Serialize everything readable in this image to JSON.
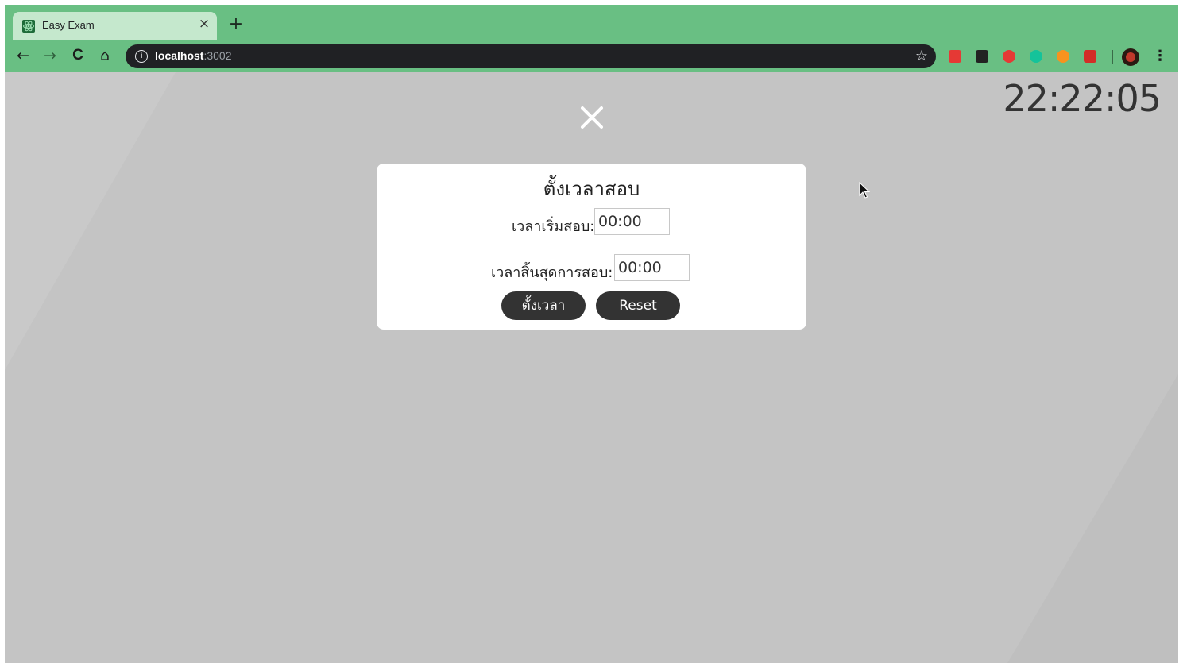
{
  "browser": {
    "tab": {
      "title": "Easy Exam",
      "close_glyph": "×",
      "favicon": "react-icon"
    },
    "new_tab_glyph": "+",
    "nav": {
      "back": "←",
      "forward": "→",
      "reload": "C",
      "home": "⌂"
    },
    "address": {
      "host": "localhost",
      "port": ":3002",
      "info_glyph": "i"
    },
    "star_glyph": "☆",
    "menu_glyph": "⋮",
    "extensions": [
      {
        "name": "ext-sync-icon",
        "color": "#e53935"
      },
      {
        "name": "ext-flag-icon",
        "color": "#222222"
      },
      {
        "name": "ext-opera-icon",
        "color": "#e53935"
      },
      {
        "name": "ext-grammarly-icon",
        "color": "#15c39a"
      },
      {
        "name": "ext-compass-icon",
        "color": "#f7931e"
      },
      {
        "name": "ext-lastpass-icon",
        "color": "#d32d27"
      }
    ]
  },
  "page": {
    "clock": "22:22:05",
    "close_icon": "close-icon",
    "modal": {
      "title": "ตั้งเวลาสอบ",
      "start_label": "เวลาเริ่มสอบ:",
      "start_value": "00:00",
      "end_label": "เวลาสิ้นสุดการสอบ:",
      "end_value": "00:00",
      "set_button": "ตั้งเวลา",
      "reset_button": "Reset"
    }
  },
  "colors": {
    "browser_accent": "#69bf83",
    "page_background": "#c4c4c4",
    "button": "#333333"
  }
}
